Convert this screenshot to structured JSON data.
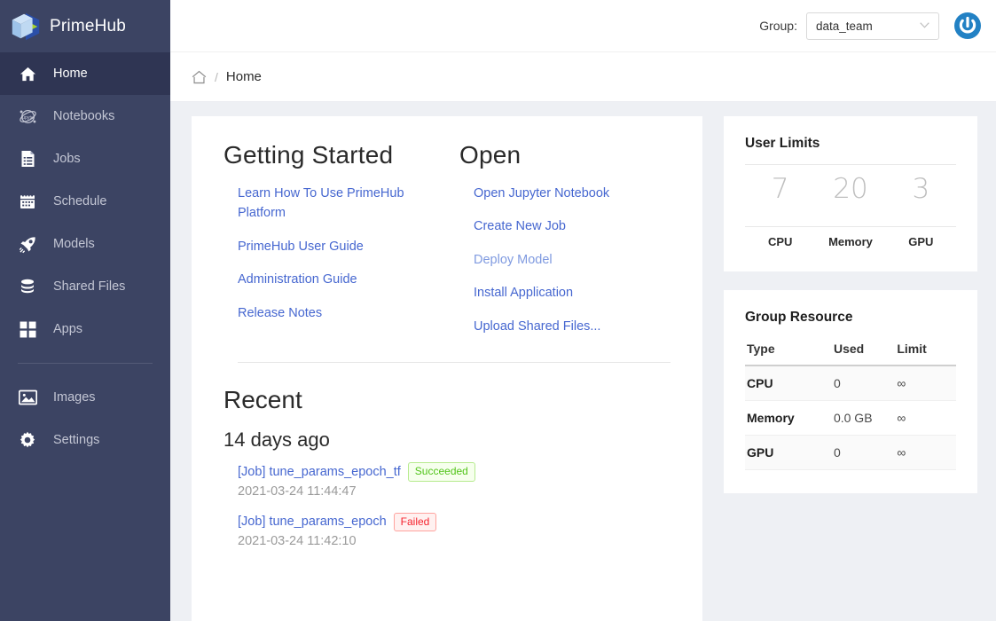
{
  "brand": {
    "name": "PrimeHub",
    "logo_icon": "primehub-cube-logo"
  },
  "sidebar": {
    "items": [
      {
        "label": "Home",
        "icon": "home-icon",
        "active": true
      },
      {
        "label": "Notebooks",
        "icon": "jupyter-notebook-icon",
        "active": false
      },
      {
        "label": "Jobs",
        "icon": "task-list-icon",
        "active": false
      },
      {
        "label": "Schedule",
        "icon": "calendar-icon",
        "active": false
      },
      {
        "label": "Models",
        "icon": "rocket-icon",
        "active": false
      },
      {
        "label": "Shared Files",
        "icon": "database-stack-icon",
        "active": false
      },
      {
        "label": "Apps",
        "icon": "grid-squares-icon",
        "active": false
      }
    ],
    "items_bottom": [
      {
        "label": "Images",
        "icon": "image-picture-icon",
        "active": false
      },
      {
        "label": "Settings",
        "icon": "gear-icon",
        "active": false
      }
    ]
  },
  "topbar": {
    "group_label": "Group:",
    "group_value": "data_team",
    "caret_icon": "chevron-down-icon",
    "power_icon": "power-logout-icon"
  },
  "breadcrumb": {
    "home_icon": "home-outline-icon",
    "separator": "/",
    "current": "Home"
  },
  "getting_started": {
    "title": "Getting Started",
    "links": [
      "Learn How To Use PrimeHub Platform",
      "PrimeHub User Guide",
      "Administration Guide",
      "Release Notes"
    ]
  },
  "open": {
    "title": "Open",
    "links": [
      "Open Jupyter Notebook",
      "Create New Job",
      "Deploy Model",
      "Install Application",
      "Upload Shared Files..."
    ]
  },
  "recent": {
    "title": "Recent",
    "day_group": "14 days ago",
    "items": [
      {
        "name": "[Job] tune_params_epoch_tf",
        "status": "Succeeded",
        "status_kind": "succeeded",
        "time": "2021-03-24 11:44:47"
      },
      {
        "name": "[Job] tune_params_epoch",
        "status": "Failed",
        "status_kind": "failed",
        "time": "2021-03-24 11:42:10"
      }
    ]
  },
  "user_limits": {
    "title": "User Limits",
    "cells": [
      {
        "value": "7",
        "label": "CPU"
      },
      {
        "value": "20",
        "label": "Memory"
      },
      {
        "value": "3",
        "label": "GPU"
      }
    ]
  },
  "group_resource": {
    "title": "Group Resource",
    "columns": [
      "Type",
      "Used",
      "Limit"
    ],
    "rows": [
      {
        "type": "CPU",
        "used": "0",
        "limit": "∞"
      },
      {
        "type": "Memory",
        "used": "0.0 GB",
        "limit": "∞"
      },
      {
        "type": "GPU",
        "used": "0",
        "limit": "∞"
      }
    ]
  },
  "colors": {
    "sidebar_bg": "#3c4463",
    "sidebar_active": "#2f3553",
    "link_blue": "#4667d0",
    "page_bg": "#eef0f4",
    "success": "#52c41a",
    "danger": "#f5222d",
    "power_blue": "#1f7dc0"
  }
}
